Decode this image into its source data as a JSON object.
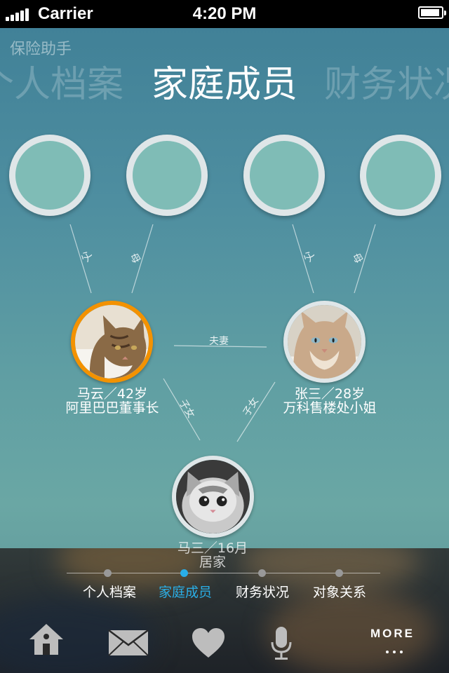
{
  "status_bar": {
    "carrier": "Carrier",
    "time": "4:20 PM"
  },
  "app": {
    "title": "保险助手"
  },
  "header_tabs": {
    "previous": "个人档案",
    "current": "家庭成员",
    "next": "财务状况"
  },
  "relations": {
    "father_left": "父",
    "mother_left": "母",
    "father_right": "父",
    "mother_right": "母",
    "spouse": "夫妻",
    "child_left": "子女",
    "child_right": "子女"
  },
  "members": [
    {
      "name_age": "马云／42岁",
      "title": "阿里巴巴董事长"
    },
    {
      "name_age": "张三／28岁",
      "title": "万科售楼处小姐"
    },
    {
      "name_age": "马三／16月",
      "title": "居家"
    }
  ],
  "bottom_nav": {
    "items": [
      "个人档案",
      "家庭成员",
      "财务状况",
      "对象关系"
    ],
    "active_index": 1,
    "more_label": "MORE"
  },
  "colors": {
    "accent": "#29aee8",
    "selected_ring": "#f39200",
    "circle_fill": "#7fbcb6"
  }
}
